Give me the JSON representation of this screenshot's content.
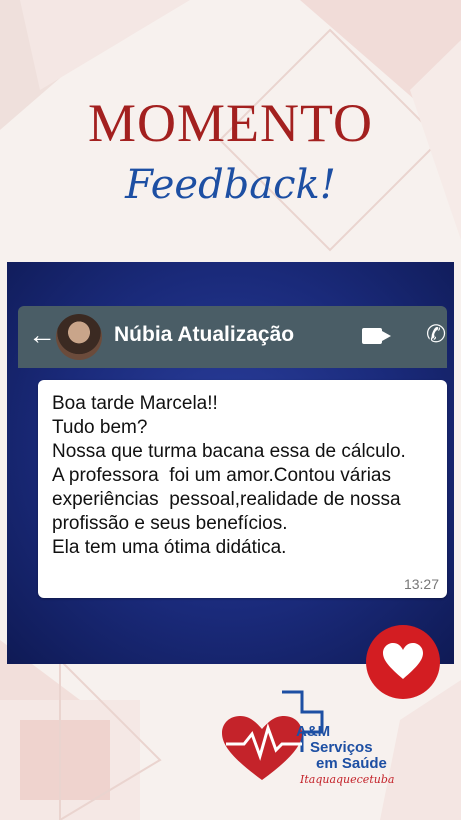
{
  "header": {
    "title": "MOMENTO",
    "subtitle": "Feedback!"
  },
  "chat": {
    "contact_name": "Núbia Atualização",
    "message": "Boa tarde Marcela!!\nTudo bem?\nNossa que turma bacana essa de cálculo.\nA professora  foi um amor.Contou várias experiências  pessoal,realidade de nossa profissão e seus benefícios.\nEla tem uma ótima didática.",
    "time": "13:27"
  },
  "logo": {
    "brand": "A&M",
    "name_line1": "Serviços",
    "name_line2": "em Saúde",
    "city": "Itaquaquecetuba"
  },
  "colors": {
    "title_red": "#a3201f",
    "subtitle_blue": "#1d4fa3",
    "header_gray": "#4a5d66",
    "heart_red": "#d31d22"
  },
  "icons": [
    "back-arrow-icon",
    "video-call-icon",
    "phone-icon",
    "heart-icon"
  ]
}
